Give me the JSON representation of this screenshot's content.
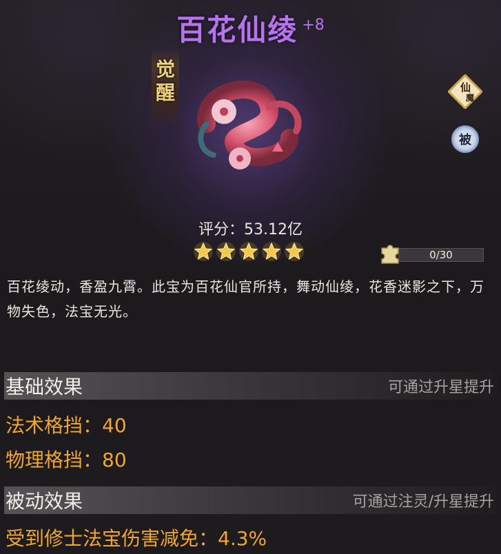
{
  "item": {
    "name": "百花仙绫",
    "level": "+8",
    "awaken_label": [
      "觉",
      "醒"
    ],
    "badge_xianmo": [
      "仙",
      "魔"
    ],
    "badge_passive": "被",
    "score_text": "评分：53.12亿",
    "stars": 5,
    "star_progress": "0/30",
    "star_progress_ratio": 0.0
  },
  "description": "百花绫动，香盈九霄。此宝为百花仙官所持，舞动仙绫，花香迷影之下，万物失色，法宝无光。",
  "base_section": {
    "title": "基础效果",
    "hint": "可通过升星提升",
    "stats": [
      "法术格挡：40",
      "物理格挡：80"
    ]
  },
  "passive_section": {
    "title": "被动效果",
    "hint": "可通过注灵/升星提升",
    "stats": [
      "受到修士法宝伤害减免：4.3%"
    ]
  },
  "colors": {
    "title_purple": "#b772ef",
    "stat_orange": "#f2a632",
    "star_gold": "#f2c94c"
  }
}
